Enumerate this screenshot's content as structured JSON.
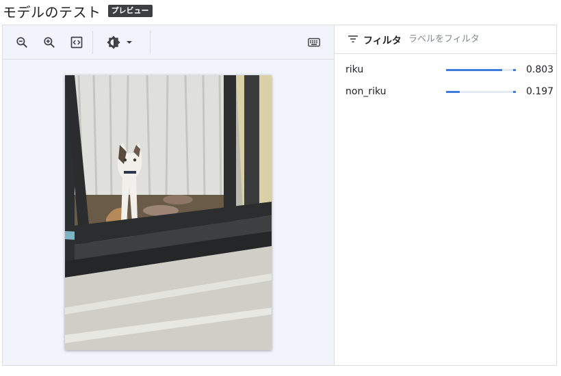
{
  "header": {
    "title": "モデルのテスト",
    "badge": "プレビュー"
  },
  "toolbar": {
    "zoom_out_icon": "zoom-out-icon",
    "zoom_in_icon": "zoom-in-icon",
    "fit_icon": "fit-to-screen-icon",
    "brightness_icon": "brightness-contrast-icon",
    "keyboard_icon": "keyboard-icon"
  },
  "filter": {
    "label": "フィルタ",
    "placeholder": "ラベルをフィルタ"
  },
  "results": [
    {
      "label": "riku",
      "score": "0.803",
      "value": 0.803
    },
    {
      "label": "non_riku",
      "score": "0.197",
      "value": 0.197
    }
  ],
  "colors": {
    "accent": "#3c7ddc",
    "badge_bg": "#3c4043",
    "pane_bg": "#f1f4fb"
  }
}
